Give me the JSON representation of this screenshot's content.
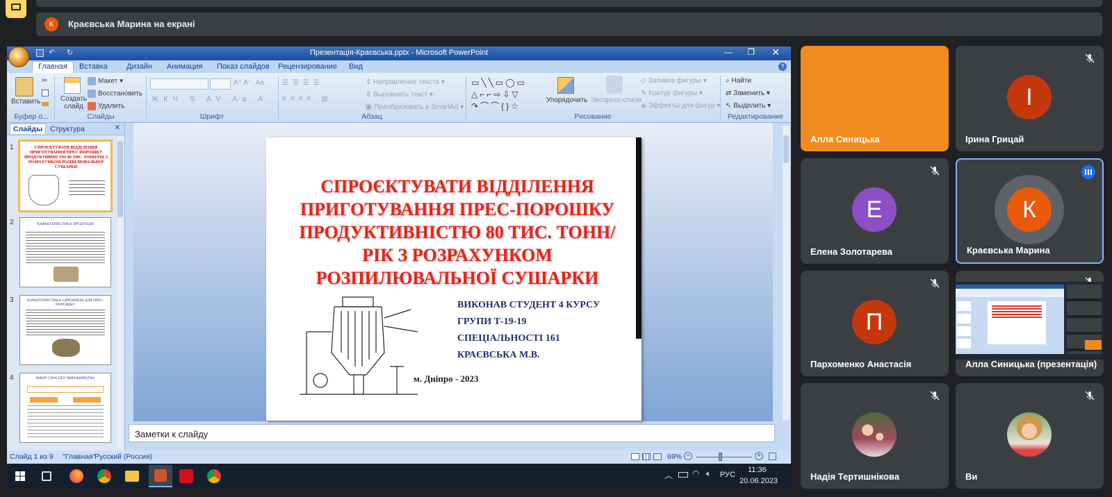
{
  "meet": {
    "top_bar_text": "",
    "presenting_banner": "Краєвська Марина на екрані",
    "presenting_avatar_letter": "К",
    "presenting_avatar_color": "#e8590c"
  },
  "ppt": {
    "window_title": "Презентація-Краєвська.pptx - Microsoft PowerPoint",
    "tabs": [
      "Главная",
      "Вставка",
      "Дизайн",
      "Анимация",
      "Показ слайдов",
      "Рецензирование",
      "Вид"
    ],
    "ribbon": {
      "paste": "Вставить",
      "create_slide": "Создать слайд",
      "layout": "Макет",
      "restore": "Восстановить",
      "delete": "Удалить",
      "text_direction": "Направление текста",
      "align_text": "Выровнять текст",
      "convert_smartart": "Преобразовать в SmartArt",
      "arrange": "Упорядочить",
      "express_styles": "Экспресс-стили",
      "shape_fill": "Заливка фигуры",
      "shape_outline": "Контур фигуры",
      "shape_effects": "Эффекты для фигур",
      "find": "Найти",
      "replace": "Заменить",
      "select": "Выделить",
      "groups": [
        "Буфер о...",
        "Слайды",
        "Шрифт",
        "Абзац",
        "Рисование",
        "Редактирование"
      ]
    },
    "side_tabs": [
      "Слайды",
      "Структура"
    ],
    "thumbnails": [
      {
        "num": "1",
        "title": "СПРОЄКТУВАТИ ВІДДІЛЕННЯ ПРИГОТУВАННЯ ПРЕС-ПОРОШКУ ПРОДУКТИВНІСТЮ 80 ТИС. ТОНН/РІК З РОЗРАХУНКОМ РОЗПИЛЮВАЛЬНОЇ СУШАРКИ"
      },
      {
        "num": "2",
        "title": "ХАРАКТЕРИСТИКА ПРОДУКЦІЇ"
      },
      {
        "num": "3",
        "title": "ХАРАКТЕРИСТИКА СИРОВИНИ ДЛЯ ПРЕС-ПОРОШКУ"
      },
      {
        "num": "4",
        "title": "ВИБІР СПОСОБУ ВИРОБНИЦТВА"
      }
    ],
    "slide": {
      "title": "СПРОЄКТУВАТИ ВІДДІЛЕННЯ ПРИГОТУВАННЯ ПРЕС-ПОРОШКУ ПРОДУКТИВНІСТЮ 80 ТИС. ТОНН/РІК З РОЗРАХУНКОМ РОЗПИЛЮВАЛЬНОЇ СУШАРКИ",
      "author_lines": [
        "ВИКОНАВ СТУДЕНТ 4 КУРСУ",
        "ГРУПИ Т-19-19",
        "СПЕЦІАЛЬНОСТІ 161",
        "КРАЄВСЬКА М.В."
      ],
      "footer": "м. Дніпро - 2023"
    },
    "notes_placeholder": "Заметки к слайду",
    "status": {
      "slide_counter": "Слайд 1 из 9",
      "theme": "\"Главная\"",
      "language": "Русский (Россия)",
      "zoom": "69%",
      "zoom_fraction": 0.4
    }
  },
  "taskbar": {
    "language": "РУС",
    "time": "11:36",
    "date": "20.06.2023"
  },
  "participants": [
    {
      "name": "Алла Синицька",
      "type": "color",
      "color": "#f28b1e",
      "muted": false
    },
    {
      "name": "Ірина Грицай",
      "letter": "І",
      "avatar_color": "#c5380e",
      "muted": true
    },
    {
      "name": "Елена Золотарева",
      "letter": "Е",
      "avatar_color": "#8e4fc6",
      "muted": true
    },
    {
      "name": "Краєвська Марина",
      "letter": "К",
      "avatar_color": "#e8590c",
      "muted": false,
      "speaking": true
    },
    {
      "name": "Пархоменко Анастасія",
      "letter": "П",
      "avatar_color": "#c5380e",
      "muted": true
    },
    {
      "name": "Алла Синицька (презентація)",
      "type": "screen",
      "muted": true
    },
    {
      "name": "Надія Тертишнікова",
      "type": "photo",
      "muted": true
    },
    {
      "name": "Ви",
      "type": "photo",
      "muted": true
    }
  ]
}
